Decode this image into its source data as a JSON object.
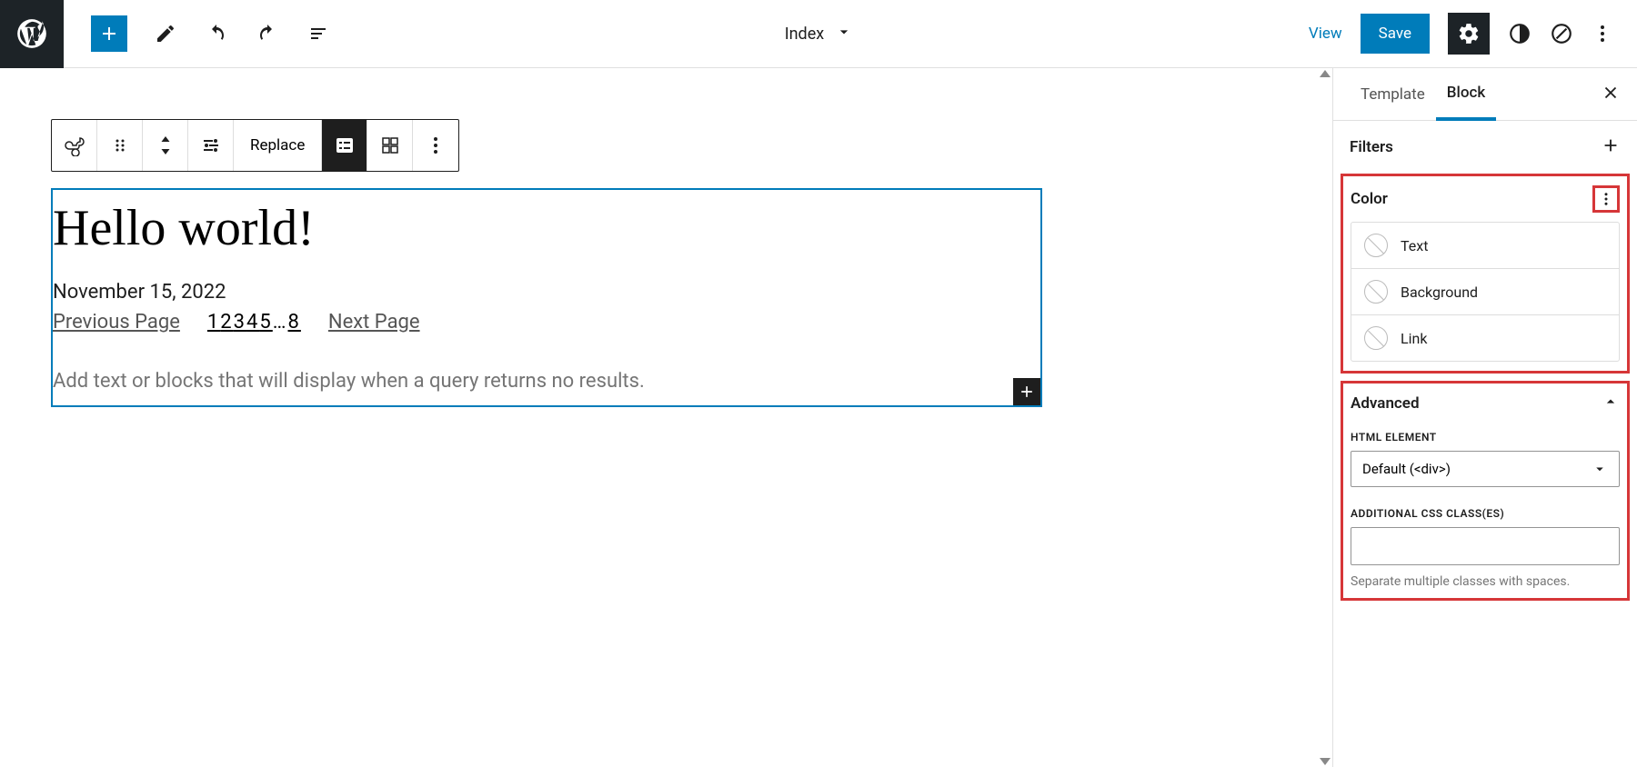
{
  "topbar": {
    "document_title": "Index",
    "view": "View",
    "save": "Save"
  },
  "block_toolbar": {
    "replace": "Replace"
  },
  "canvas": {
    "post_title": "Hello world!",
    "post_date": "November 15, 2022",
    "prev_page": "Previous Page",
    "next_page": "Next Page",
    "page_numbers": [
      "1",
      "2",
      "3",
      "4",
      "5",
      "…",
      "8"
    ],
    "no_results_placeholder": "Add text or blocks that will display when a query returns no results."
  },
  "sidebar": {
    "tab_template": "Template",
    "tab_block": "Block",
    "filters_label": "Filters",
    "color_label": "Color",
    "color_items": {
      "text": "Text",
      "background": "Background",
      "link": "Link"
    },
    "advanced_label": "Advanced",
    "html_element_label": "HTML ELEMENT",
    "html_element_value": "Default (<div>)",
    "css_classes_label": "ADDITIONAL CSS CLASS(ES)",
    "css_classes_help": "Separate multiple classes with spaces."
  }
}
